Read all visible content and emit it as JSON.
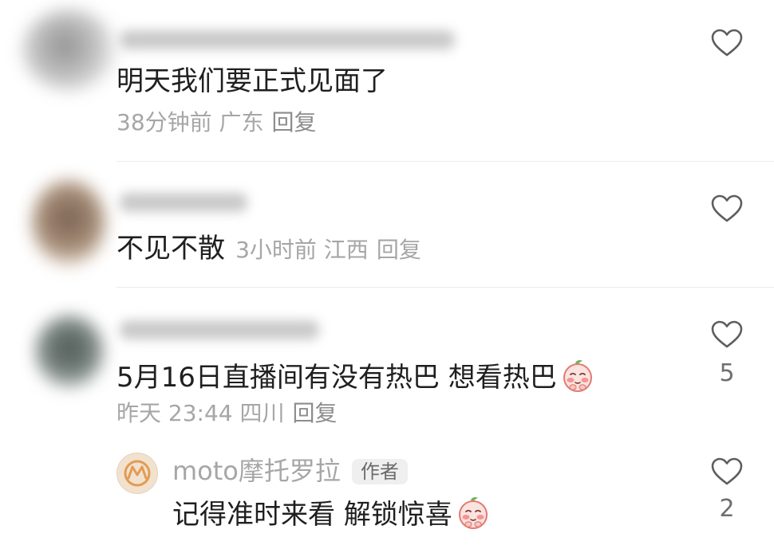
{
  "comments": [
    {
      "text": "明天我们要正式见面了",
      "meta": "38分钟前 广东",
      "reply_label": "回复",
      "like_count": ""
    },
    {
      "text": "不见不散",
      "meta": "3小时前 江西",
      "reply_label": "回复",
      "like_count": ""
    },
    {
      "text": "5月16日直播间有没有热巴 想看热巴",
      "meta": "昨天 23:44 四川",
      "reply_label": "回复",
      "like_count": "5"
    }
  ],
  "reply": {
    "author": "moto摩托罗拉",
    "badge": "作者",
    "text": "记得准时来看 解锁惊喜",
    "like_count": "2"
  },
  "icons": {
    "like": "heart-outline-icon",
    "emoji": "shy-peach-emoji-icon",
    "brand_avatar": "motorola-logo-icon"
  },
  "colors": {
    "text_primary": "#1f1f1f",
    "text_secondary": "#a6a6a6",
    "divider": "#ececec",
    "icon_stroke": "#5d5d5d",
    "emoji_face": "#fbe3df",
    "emoji_cheek": "#f07a7a",
    "brand_orange": "#e39b53"
  }
}
